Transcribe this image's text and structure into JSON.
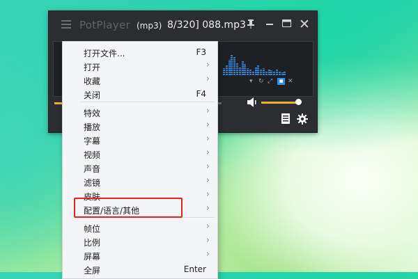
{
  "player": {
    "app_name": "PotPlayer",
    "format": "(mp3)",
    "track": "8/320] 088.mp3",
    "close_glyph": "✕"
  },
  "colors": {
    "accent": "#e7b52b",
    "highlight_box": "#e3211d",
    "viz_bars": "#2f7fd0"
  },
  "menu": {
    "items": [
      {
        "label": "打开文件...",
        "shortcut": "F3",
        "submenu": false
      },
      {
        "label": "打开",
        "shortcut": "",
        "submenu": true
      },
      {
        "label": "收藏",
        "shortcut": "",
        "submenu": true
      },
      {
        "label": "关闭",
        "shortcut": "F4",
        "submenu": false
      },
      {
        "label": "特效",
        "shortcut": "",
        "submenu": true
      },
      {
        "label": "播放",
        "shortcut": "",
        "submenu": true
      },
      {
        "label": "字幕",
        "shortcut": "",
        "submenu": true
      },
      {
        "label": "视频",
        "shortcut": "",
        "submenu": true
      },
      {
        "label": "声音",
        "shortcut": "",
        "submenu": true
      },
      {
        "label": "滤镜",
        "shortcut": "",
        "submenu": true
      },
      {
        "label": "皮肤",
        "shortcut": "",
        "submenu": true
      },
      {
        "label": "配置/语言/其他",
        "shortcut": "",
        "submenu": true
      },
      {
        "label": "帧位",
        "shortcut": "",
        "submenu": true
      },
      {
        "label": "比例",
        "shortcut": "",
        "submenu": true
      },
      {
        "label": "屏幕",
        "shortcut": "",
        "submenu": true
      },
      {
        "label": "全屏",
        "shortcut": "Enter",
        "submenu": false
      }
    ],
    "arrow_glyph": "›"
  }
}
